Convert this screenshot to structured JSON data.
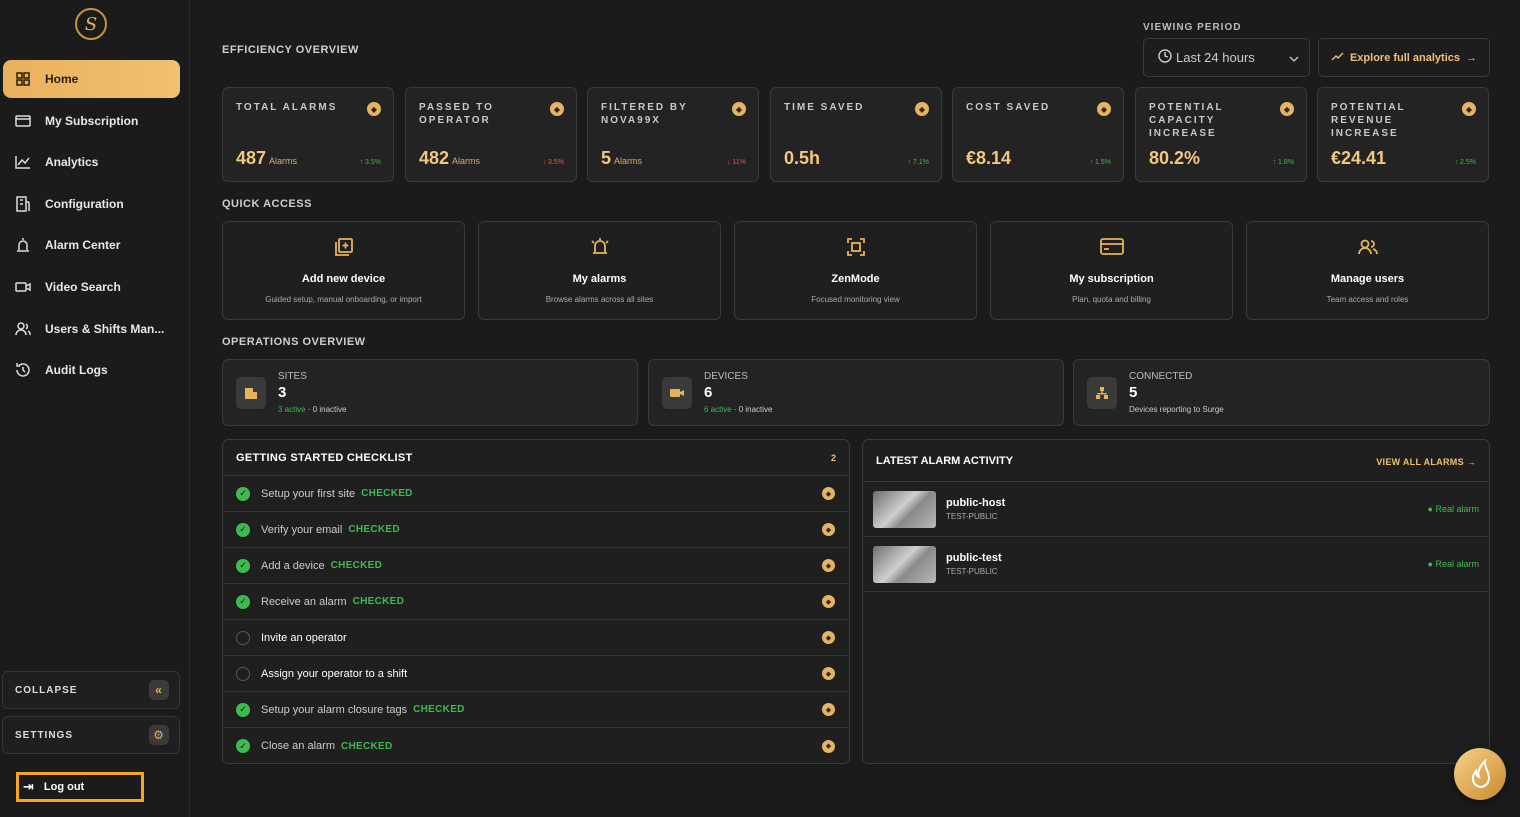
{
  "sidebar": {
    "logo": "S",
    "items": [
      {
        "label": "Home",
        "icon": "grid-icon"
      },
      {
        "label": "My Subscription",
        "icon": "card-icon"
      },
      {
        "label": "Analytics",
        "icon": "chart-icon"
      },
      {
        "label": "Configuration",
        "icon": "building-icon"
      },
      {
        "label": "Alarm Center",
        "icon": "siren-icon"
      },
      {
        "label": "Video Search",
        "icon": "video-icon"
      },
      {
        "label": "Users & Shifts Man...",
        "icon": "users-icon"
      },
      {
        "label": "Audit Logs",
        "icon": "history-icon"
      }
    ],
    "collapse_label": "COLLAPSE",
    "settings_label": "SETTINGS",
    "logout_label": "Log out"
  },
  "header": {
    "efficiency_title": "EFFICIENCY OVERVIEW",
    "viewing_period_label": "VIEWING PERIOD",
    "viewing_period_value": "Last 24 hours",
    "explore_label": "Explore full analytics"
  },
  "kpis": [
    {
      "label": "TOTAL ALARMS",
      "value": "487",
      "unit": "Alarms",
      "trend": "↑ 3.5%",
      "dir": "up"
    },
    {
      "label": "PASSED TO OPERATOR",
      "value": "482",
      "unit": "Alarms",
      "trend": "↓ 3.5%",
      "dir": "down"
    },
    {
      "label": "FILTERED BY NOVA99X",
      "value": "5",
      "unit": "Alarms",
      "trend": "↓ 11%",
      "dir": "down"
    },
    {
      "label": "TIME SAVED",
      "value": "0.5h",
      "unit": "",
      "trend": "↑ 7.1%",
      "dir": "up"
    },
    {
      "label": "COST SAVED",
      "value": "€8.14",
      "unit": "",
      "trend": "↑ 1.5%",
      "dir": "up"
    },
    {
      "label": "POTENTIAL CAPACITY INCREASE",
      "value": "80.2%",
      "unit": "",
      "trend": "↑ 1.8%",
      "dir": "up"
    },
    {
      "label": "POTENTIAL REVENUE INCREASE",
      "value": "€24.41",
      "unit": "",
      "trend": "↑ 2.5%",
      "dir": "up"
    }
  ],
  "quick_access": {
    "title": "QUICK ACCESS",
    "items": [
      {
        "title": "Add new device",
        "sub": "Guided setup, manual onboarding, or import",
        "icon": "add-device-icon"
      },
      {
        "title": "My alarms",
        "sub": "Browse alarms across all sites",
        "icon": "bell-icon"
      },
      {
        "title": "ZenMode",
        "sub": "Focused monitoring view",
        "icon": "focus-icon"
      },
      {
        "title": "My subscription",
        "sub": "Plan, quota and billing",
        "icon": "card-icon"
      },
      {
        "title": "Manage users",
        "sub": "Team access and roles",
        "icon": "users-icon"
      }
    ]
  },
  "operations": {
    "title": "OPERATIONS OVERVIEW",
    "items": [
      {
        "label": "SITES",
        "value": "3",
        "active": "3 active",
        "rest": " · 0 inactive",
        "icon": "building-icon"
      },
      {
        "label": "DEVICES",
        "value": "6",
        "active": "6 active",
        "rest": " · 0 inactive",
        "icon": "camera-icon"
      },
      {
        "label": "CONNECTED",
        "value": "5",
        "active": "",
        "rest": "Devices reporting to Surge",
        "icon": "network-icon"
      }
    ]
  },
  "checklist": {
    "title": "GETTING STARTED CHECKLIST",
    "count": "2",
    "items": [
      {
        "text": "Setup your first site",
        "status": "CHECKED",
        "done": true
      },
      {
        "text": "Verify your email",
        "status": "CHECKED",
        "done": true
      },
      {
        "text": "Add a device",
        "status": "CHECKED",
        "done": true
      },
      {
        "text": "Receive an alarm",
        "status": "CHECKED",
        "done": true
      },
      {
        "text": "Invite an operator",
        "status": "",
        "done": false
      },
      {
        "text": "Assign your operator to a shift",
        "status": "",
        "done": false
      },
      {
        "text": "Setup your alarm closure tags",
        "status": "CHECKED",
        "done": true
      },
      {
        "text": "Close an alarm",
        "status": "CHECKED",
        "done": true
      }
    ]
  },
  "alarms": {
    "title": "LATEST ALARM ACTIVITY",
    "view_all": "VIEW ALL ALARMS",
    "items": [
      {
        "name": "public-host",
        "site": "TEST-PUBLIC",
        "tag": "● Real alarm"
      },
      {
        "name": "public-test",
        "site": "TEST-PUBLIC",
        "tag": "● Real alarm"
      }
    ]
  },
  "colors": {
    "accent": "#f0c170",
    "success": "#3fb950",
    "danger": "#e05a4a",
    "bg": "#1b1b1b"
  }
}
